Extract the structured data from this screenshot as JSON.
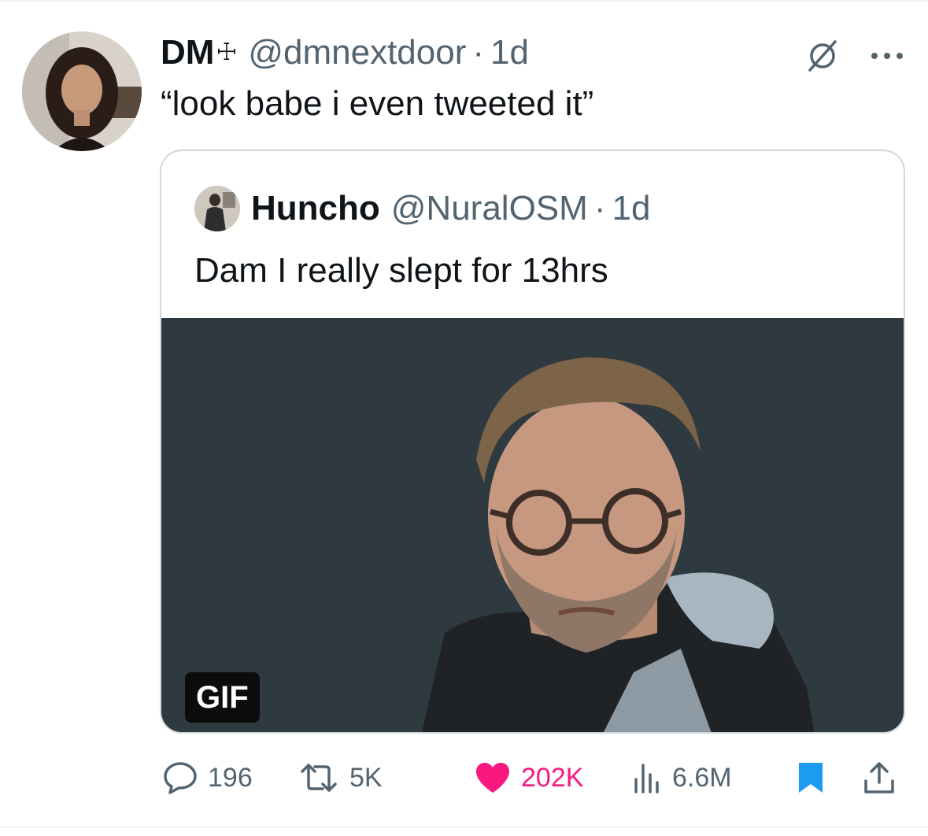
{
  "tweet": {
    "author": {
      "display_name": "DM",
      "name_emoji": "☩",
      "handle": "@dmnextdoor",
      "separator": "·",
      "time": "1d",
      "avatar_icon": "profile-photo"
    },
    "text": "“look babe i even tweeted it”",
    "header_icons": [
      "grok-icon",
      "more-icon"
    ],
    "more_label": "···"
  },
  "quote": {
    "author": {
      "display_name": "Huncho",
      "handle": "@NuralOSM",
      "separator": "·",
      "time": "1d",
      "avatar_icon": "profile-photo"
    },
    "text": "Dam I really slept for 13hrs",
    "media": {
      "type": "gif",
      "badge": "GIF",
      "background_color": "#2e3a3f"
    }
  },
  "actions": {
    "reply": {
      "count": "196",
      "icon": "reply-icon"
    },
    "retweet": {
      "count": "5K",
      "icon": "retweet-icon"
    },
    "like": {
      "count": "202K",
      "icon": "heart-icon",
      "active": true,
      "color": "#f91880"
    },
    "views": {
      "count": "6.6M",
      "icon": "views-icon"
    },
    "bookmark": {
      "icon": "bookmark-icon",
      "active": true,
      "color": "#1d9bf0"
    },
    "share": {
      "icon": "share-icon"
    }
  },
  "colors": {
    "text_primary": "#0f1419",
    "text_secondary": "#536471",
    "border": "#cfd9de",
    "like": "#f91880",
    "accent": "#1d9bf0"
  }
}
